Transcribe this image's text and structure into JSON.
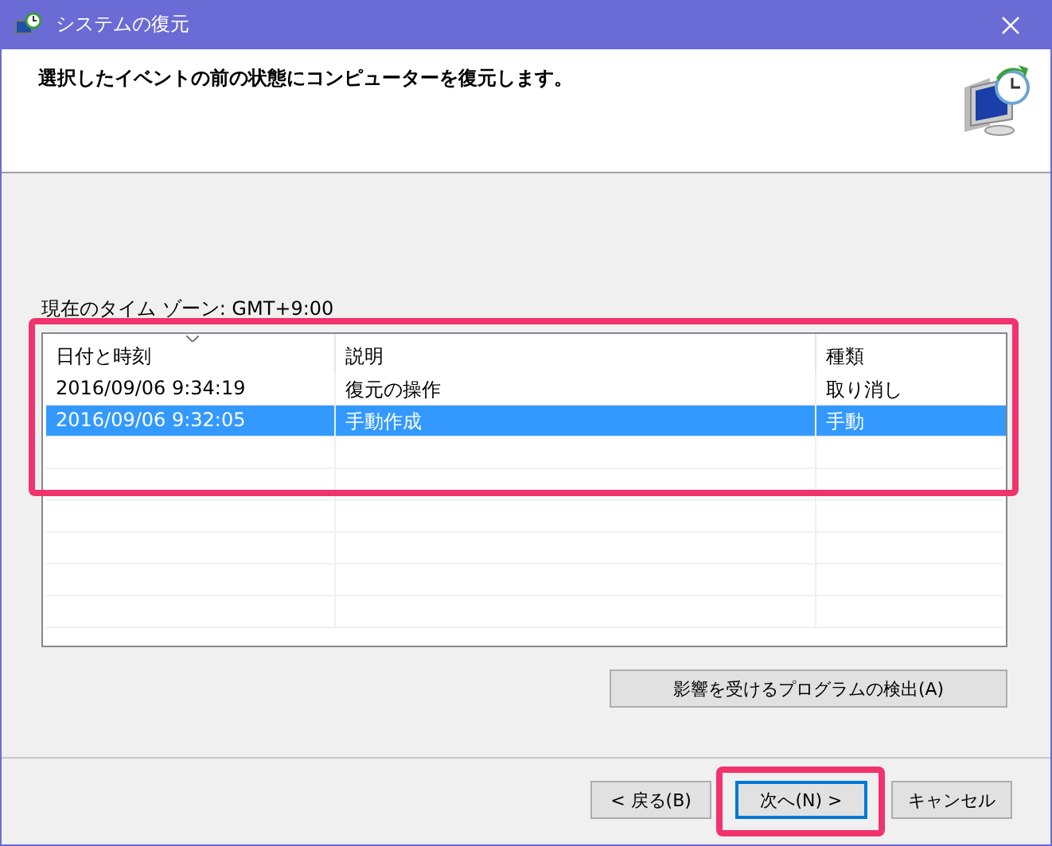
{
  "window": {
    "title": "システムの復元"
  },
  "header": {
    "text": "選択したイベントの前の状態にコンピューターを復元します。"
  },
  "timezone": {
    "text": "現在のタイム ゾーン: GMT+9:00"
  },
  "table": {
    "highlighted": true,
    "columns": [
      {
        "label": "日付と時刻",
        "sorted": true
      },
      {
        "label": "説明",
        "sorted": false
      },
      {
        "label": "種類",
        "sorted": false
      }
    ],
    "rows": [
      {
        "cells": [
          "2016/09/06 9:34:19",
          "復元の操作",
          "取り消し"
        ],
        "selected": false
      },
      {
        "cells": [
          "2016/09/06 9:32:05",
          "手動作成",
          "手動"
        ],
        "selected": true
      }
    ]
  },
  "scan_button": {
    "label": "影響を受けるプログラムの検出(A)"
  },
  "buttons": [
    {
      "label": "< 戻る(B)",
      "default": false,
      "highlighted": false
    },
    {
      "label": "次へ(N) >",
      "default": true,
      "highlighted": true
    },
    {
      "label": "キャンセル",
      "default": false,
      "highlighted": false
    }
  ]
}
